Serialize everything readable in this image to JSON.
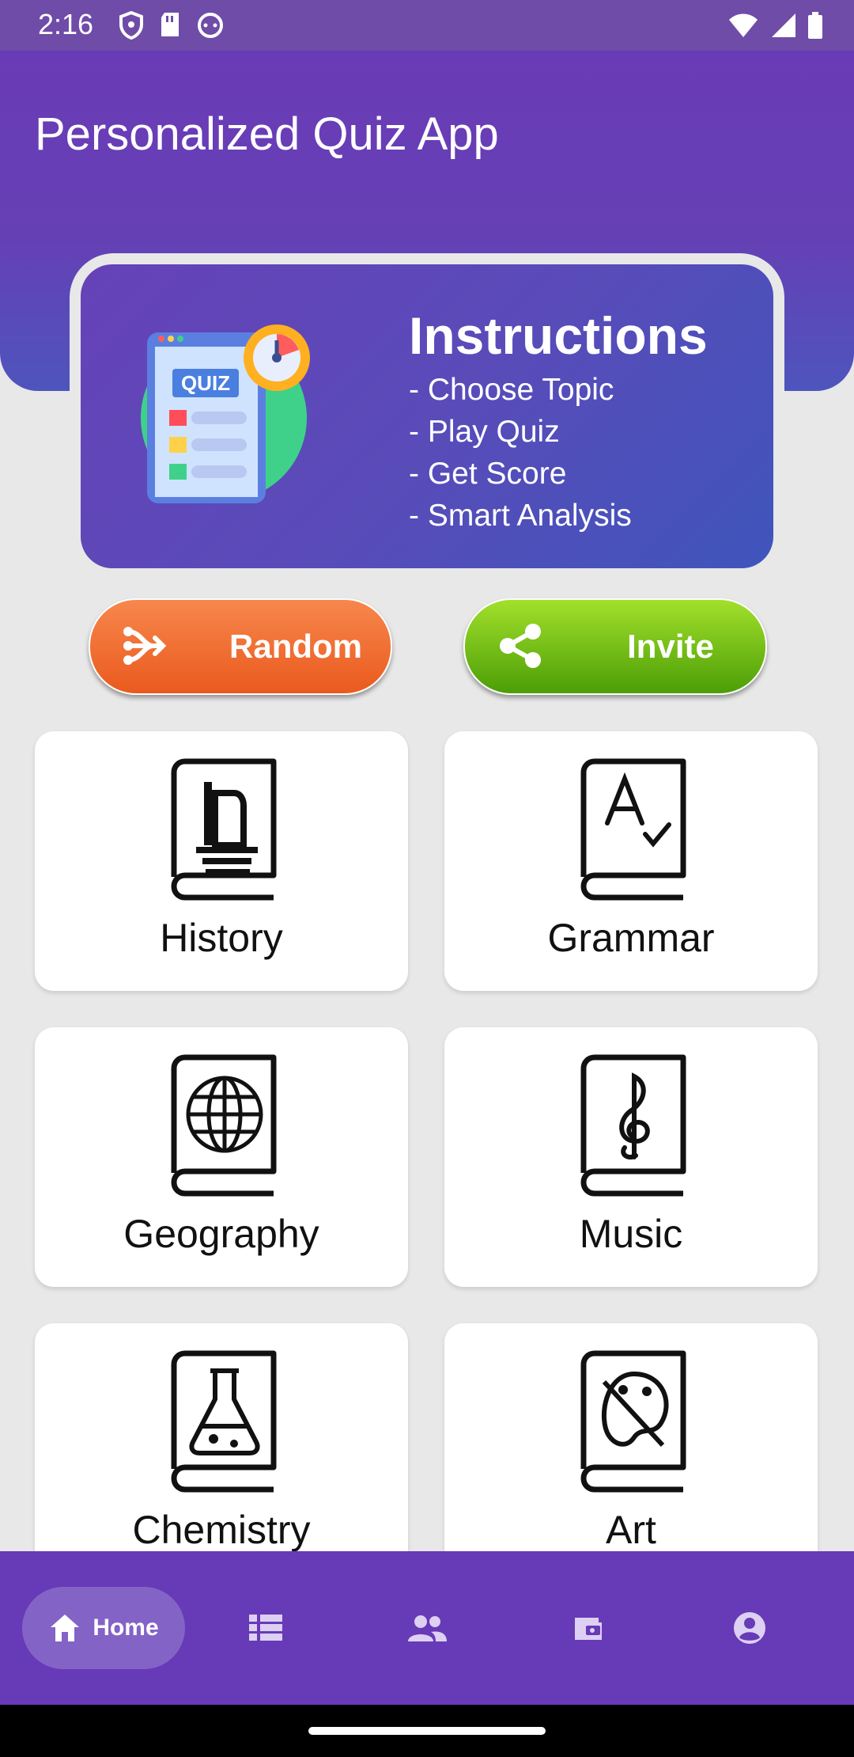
{
  "status_bar": {
    "time": "2:16",
    "left_icons": [
      "shield-icon",
      "sd-card-icon",
      "android-icon"
    ],
    "right_icons": [
      "wifi-icon",
      "signal-icon",
      "battery-icon"
    ]
  },
  "header": {
    "title": "Personalized Quiz App"
  },
  "instructions": {
    "illustration_text": "QUIZ",
    "title": "Instructions",
    "items": [
      "- Choose Topic",
      "- Play Quiz",
      "- Get Score",
      "- Smart Analysis"
    ]
  },
  "actions": {
    "random_label": "Random",
    "invite_label": "Invite"
  },
  "topics": [
    {
      "label": "History",
      "icon": "history-book-icon"
    },
    {
      "label": "Grammar",
      "icon": "grammar-book-icon"
    },
    {
      "label": "Geography",
      "icon": "geography-book-icon"
    },
    {
      "label": "Music",
      "icon": "music-book-icon"
    },
    {
      "label": "Chemistry",
      "icon": "chemistry-book-icon"
    },
    {
      "label": "Art",
      "icon": "art-book-icon"
    }
  ],
  "bottom_nav": {
    "items": [
      {
        "label": "Home",
        "icon": "home-icon",
        "selected": true
      },
      {
        "label": "",
        "icon": "list-icon"
      },
      {
        "label": "",
        "icon": "people-icon"
      },
      {
        "label": "",
        "icon": "wallet-icon"
      },
      {
        "label": "",
        "icon": "account-icon"
      }
    ]
  },
  "colors": {
    "primary": "#673ab7",
    "random_button": "#ee6a2c",
    "invite_button": "#66b416",
    "background": "#e8e8e8"
  }
}
